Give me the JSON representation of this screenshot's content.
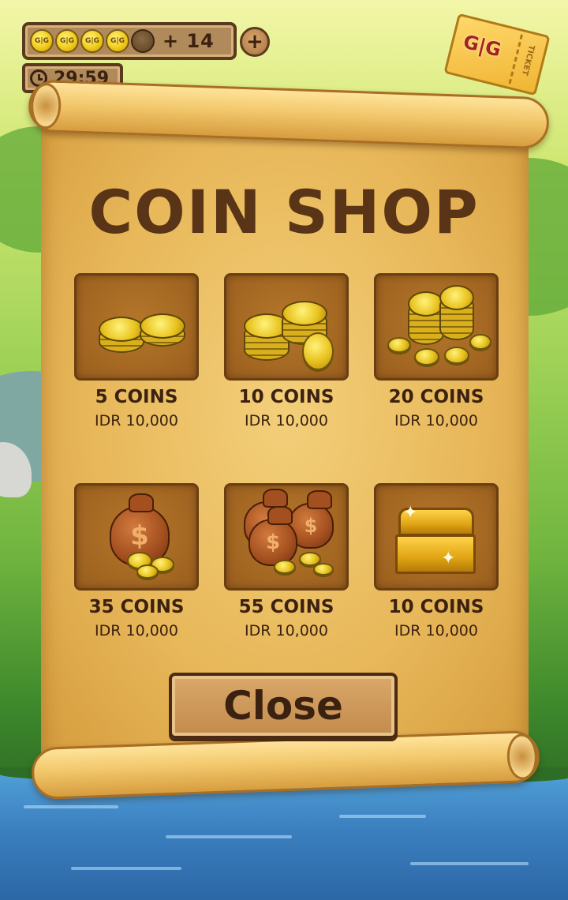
{
  "hud": {
    "coin_label": "G|G",
    "lives_count": "+ 14",
    "add_label": "+",
    "timer": "29:59"
  },
  "ticket": {
    "logo": "G|G",
    "label": "TICKET"
  },
  "shop": {
    "title": "COIN SHOP",
    "items": [
      {
        "name": "5 COINS",
        "price": "IDR 10,000",
        "icon": "coin-stack-small-icon"
      },
      {
        "name": "10 COINS",
        "price": "IDR 10,000",
        "icon": "coin-stack-medium-icon"
      },
      {
        "name": "20 COINS",
        "price": "IDR 10,000",
        "icon": "coin-pile-icon"
      },
      {
        "name": "35 COINS",
        "price": "IDR 10,000",
        "icon": "money-bag-icon"
      },
      {
        "name": "55 COINS",
        "price": "IDR 10,000",
        "icon": "money-bags-icon"
      },
      {
        "name": "10 COINS",
        "price": "IDR 10,000",
        "icon": "treasure-chest-icon"
      }
    ],
    "close_label": "Close"
  },
  "icons": {
    "bag_symbol": "$",
    "sparkle": "✦"
  }
}
